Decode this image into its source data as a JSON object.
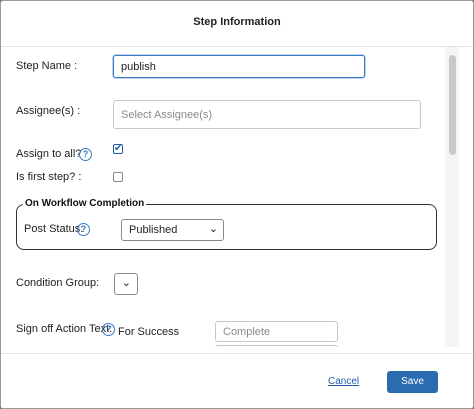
{
  "dialog": {
    "title": "Step Information"
  },
  "form": {
    "step_name_label": "Step Name :",
    "step_name_value": "publish",
    "assignees_label": "Assignee(s) :",
    "assignees_placeholder": "Select Assignee(s)",
    "assign_to_all_label": "Assign to all?",
    "assign_to_all_checked": true,
    "is_first_step_label": "Is first step? :",
    "is_first_step_checked": false,
    "on_completion": {
      "legend": "On Workflow Completion",
      "post_status_label": "Post Status:",
      "post_status_value": "Published"
    },
    "condition_group_label": "Condition Group:",
    "sign_off_label": "Sign off Action Text:",
    "for_success_label": "For Success",
    "for_success_placeholder": "Complete"
  },
  "footer": {
    "cancel_label": "Cancel",
    "save_label": "Save"
  },
  "icons": {
    "help": "question-circle-icon",
    "chevron": "chevron-down-icon",
    "check": "checkmark-icon"
  },
  "colors": {
    "accent": "#2b6cb0",
    "link": "#1d5fa8"
  }
}
